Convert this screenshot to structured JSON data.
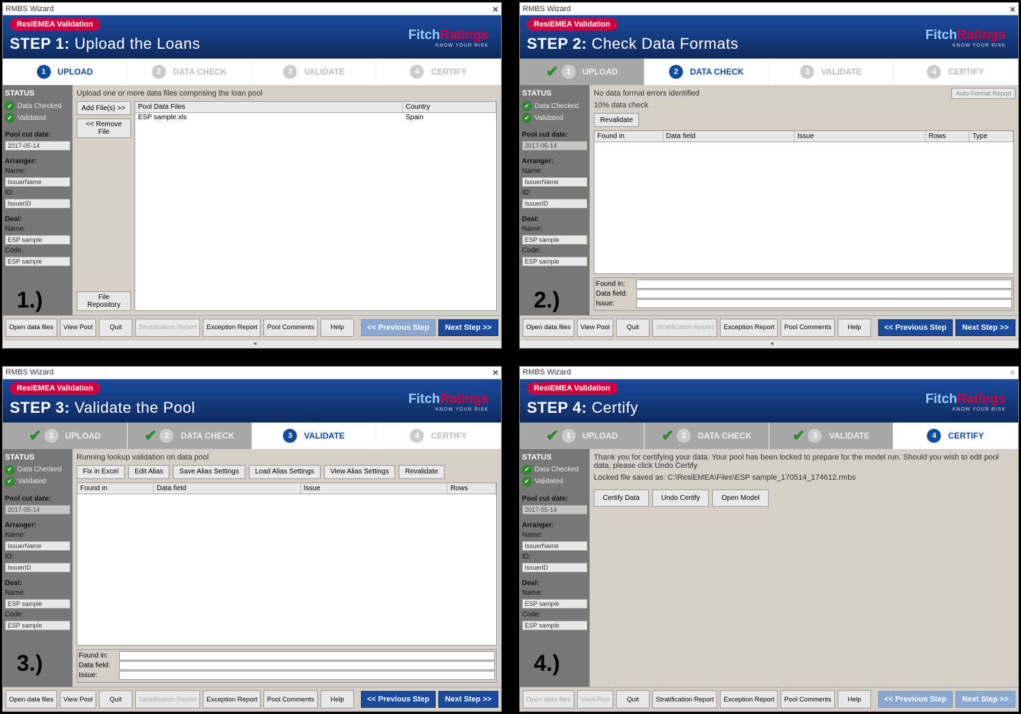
{
  "window_title": "RMBS Wizard",
  "badge": "ResiEMEA Validation",
  "logo": {
    "fitch": "Fitch",
    "ratings": "Ratings",
    "sub": "KNOW YOUR RISK"
  },
  "numbers": [
    "1.)",
    "2.)",
    "3.)",
    "4.)"
  ],
  "stepbar": {
    "labels": [
      "UPLOAD",
      "DATA CHECK",
      "VALIDATE",
      "CERTIFY"
    ],
    "nums": [
      "1",
      "2",
      "3",
      "4"
    ]
  },
  "steps": [
    {
      "num": "STEP 1:",
      "title": "Upload the Loans"
    },
    {
      "num": "STEP 2:",
      "title": "Check Data Formats"
    },
    {
      "num": "STEP 3:",
      "title": "Validate the Pool"
    },
    {
      "num": "STEP 4:",
      "title": "Certify"
    }
  ],
  "sidebar": {
    "status": "STATUS",
    "data_checked": "Data Checked",
    "validated": "Validated",
    "pool_cut": "Pool cut date:",
    "pool_cut_val": "2017-05-14",
    "arranger": "Arranger:",
    "name": "Name:",
    "name_val": "IssuerName",
    "id": "ID:",
    "id_val": "IssuerID",
    "deal": "Deal:",
    "deal_name_val": "ESP sample",
    "code": "Code:",
    "code_val": "ESP sample"
  },
  "p1": {
    "msg": "Upload one or more data files comprising the loan pool",
    "add": "Add File(s) >>",
    "remove": "<< Remove File",
    "repo": "File Repository",
    "col_pool": "Pool Data Files",
    "col_country": "Country",
    "row_file": "ESP sample.xls",
    "row_country": "Spain"
  },
  "p2": {
    "msg1": "No data format errors identified",
    "msg2": "10% data check",
    "reval": "Revalidate",
    "autof": "Auto-Format Report",
    "cols": {
      "found": "Found in",
      "field": "Data field",
      "issue": "Issue",
      "rows": "Rows",
      "type": "Type"
    },
    "det": {
      "found": "Found in:",
      "field": "Data field:",
      "issue": "Issue:"
    }
  },
  "p3": {
    "msg": "Running lookup validation on data pool",
    "fix": "Fix in Excel",
    "edit": "Edit Alias",
    "save": "Save Alias Settings",
    "load": "Load Alias Settings",
    "view": "View Alias Settings",
    "reval": "Revalidate",
    "cols": {
      "found": "Found in",
      "field": "Data field",
      "issue": "Issue",
      "rows": "Rows"
    },
    "det": {
      "found": "Found in:",
      "field": "Data field:",
      "issue": "Issue:"
    }
  },
  "p4": {
    "msg1": "Thank you for certifying your data. Your pool has been locked to prepare for the model run. Should you wish to edit pool data, please click Undo Certify",
    "msg2": "Locked file saved as: C:\\ResiEMEA\\Files\\ESP sample_170514_174612.rmbs",
    "cert": "Certify Data",
    "undo": "Undo Certify",
    "open": "Open Model"
  },
  "footer": {
    "open": "Open data files",
    "view": "View Pool",
    "quit": "Quit",
    "strat": "Stratification Report",
    "exc": "Exception Report",
    "pool": "Pool Comments",
    "help": "Help",
    "prev": "<< Previous Step",
    "next": "Next Step >>"
  }
}
